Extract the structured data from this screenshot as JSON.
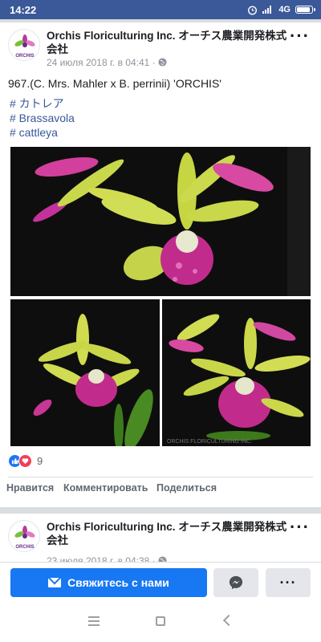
{
  "status_bar": {
    "time": "14:22",
    "network": "4G",
    "battery_level": 0.8,
    "icons": [
      "alarm-icon",
      "signal-icon",
      "network-icon",
      "battery-icon"
    ]
  },
  "post1": {
    "author": "Orchis Floriculturing Inc. オーチス農業開発株式会社",
    "timestamp": "24 июля 2018 г. в 04:41 ·",
    "text": "967.(C. Mrs. Mahler x B. perrinii) 'ORCHIS'",
    "hashtags": [
      "# カトレア",
      "# Brassavola",
      "# cattleya"
    ],
    "reaction_count": "9",
    "actions": {
      "like": "Нравится",
      "comment": "Комментировать",
      "share": "Поделиться"
    },
    "watermark": "ORCHIS FLORICULTURING INC."
  },
  "post2": {
    "author": "Orchis Floriculturing Inc. オーチス農業開発株式会社",
    "timestamp": "23 июля 2018 г. в 04:38 ·"
  },
  "cta": {
    "contact_label": "Свяжитесь с нами",
    "more_label": "···"
  },
  "colors": {
    "facebook_blue": "#3b5998",
    "button_blue": "#1877f2",
    "link_blue": "#385898",
    "love_red": "#f33e58"
  }
}
